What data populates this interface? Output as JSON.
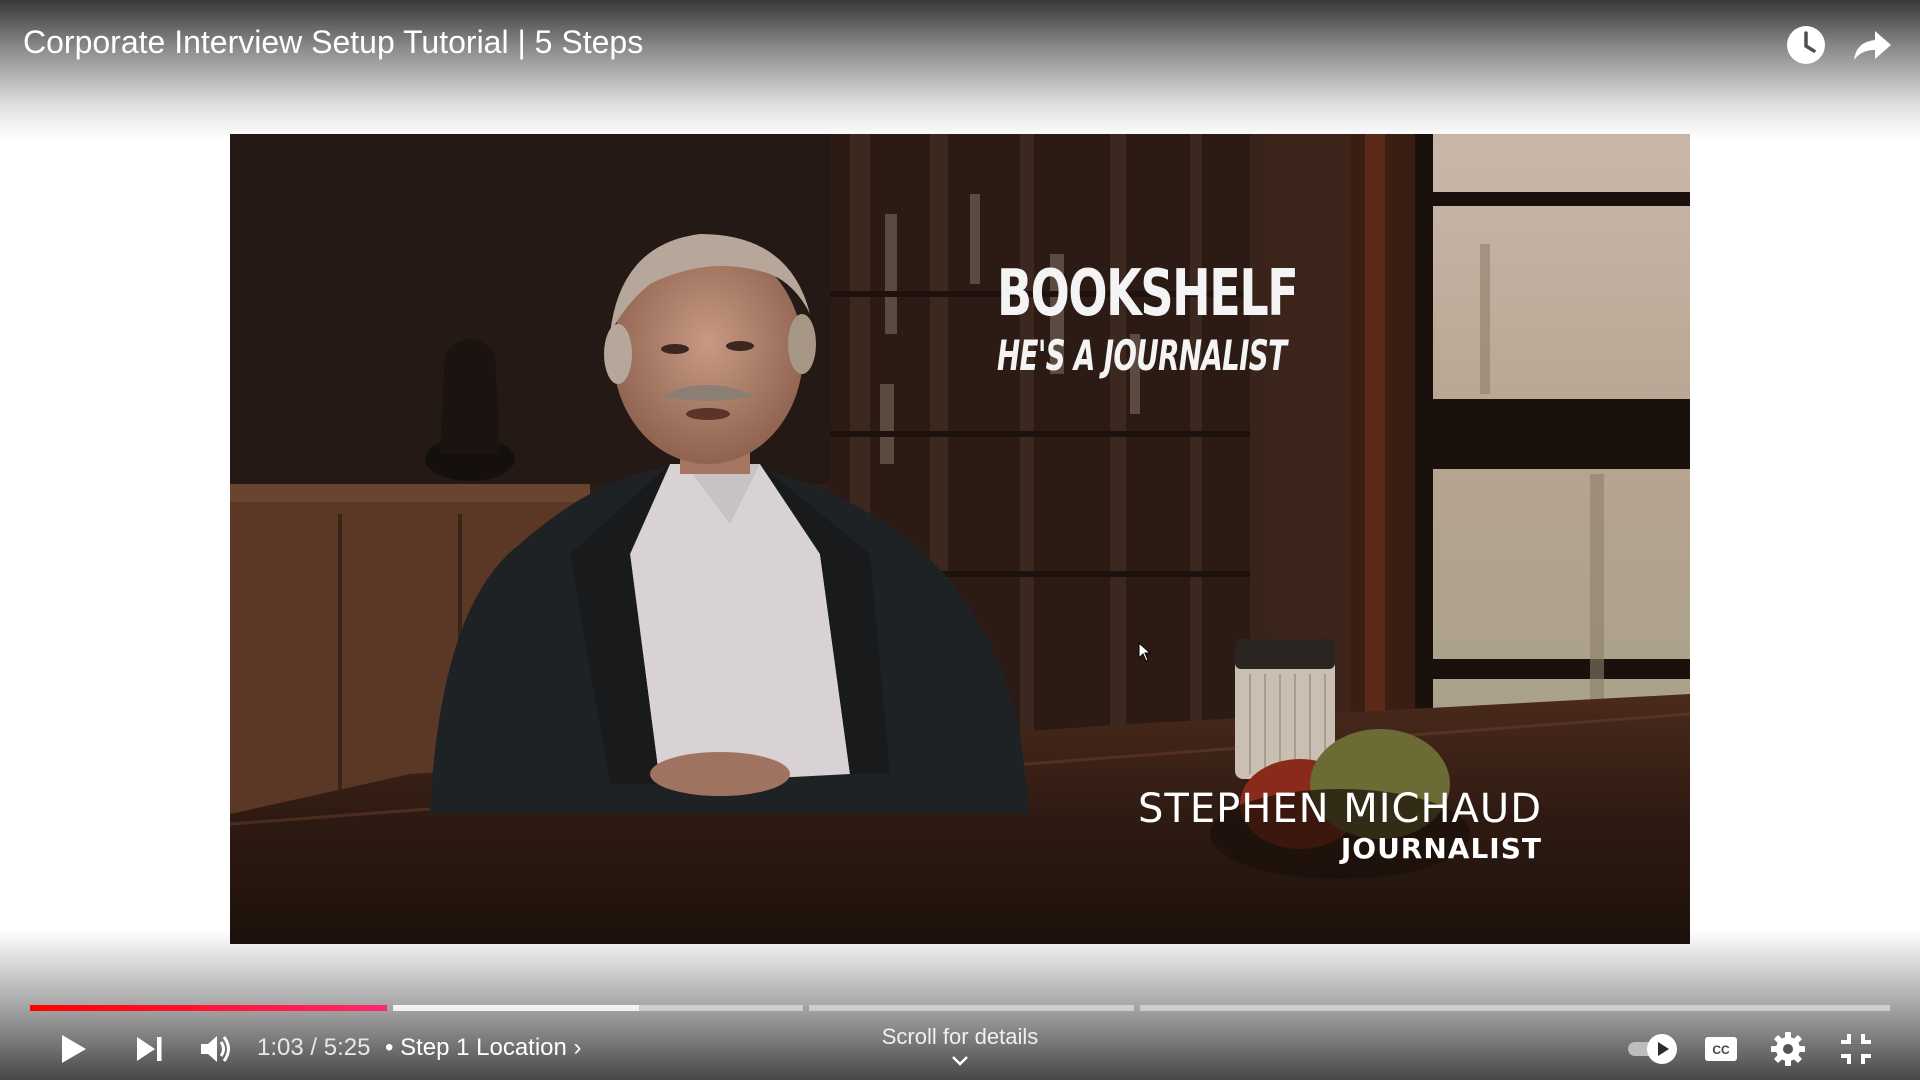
{
  "header": {
    "title": "Corporate Interview Setup Tutorial | 5 Steps",
    "watch_later_icon": "clock-icon",
    "share_icon": "share-arrow-icon"
  },
  "video": {
    "overlay_title": "BOOKSHELF",
    "overlay_subtitle": "HE'S A JOURNALIST",
    "lower_third_name": "STEPHEN MICHAUD",
    "lower_third_role": "JOURNALIST"
  },
  "progress": {
    "current_time": "1:03",
    "duration": "5:25",
    "played_fraction": 0.194,
    "chapters": [
      {
        "played_fraction": 1.0
      },
      {
        "played_fraction": 0.0
      },
      {
        "played_fraction": 0.0
      },
      {
        "played_fraction": 0.0
      }
    ],
    "accent_color": "#ff0000"
  },
  "controls": {
    "time_display": "1:03 / 5:25",
    "separator": "•",
    "chapter_label": "Step 1 Location",
    "chapter_chevron": "›",
    "scroll_hint": "Scroll for details",
    "icons": [
      "play-icon",
      "next-icon",
      "volume-icon",
      "autoplay-toggle-icon",
      "captions-icon",
      "settings-gear-icon",
      "exit-fullscreen-icon"
    ]
  }
}
